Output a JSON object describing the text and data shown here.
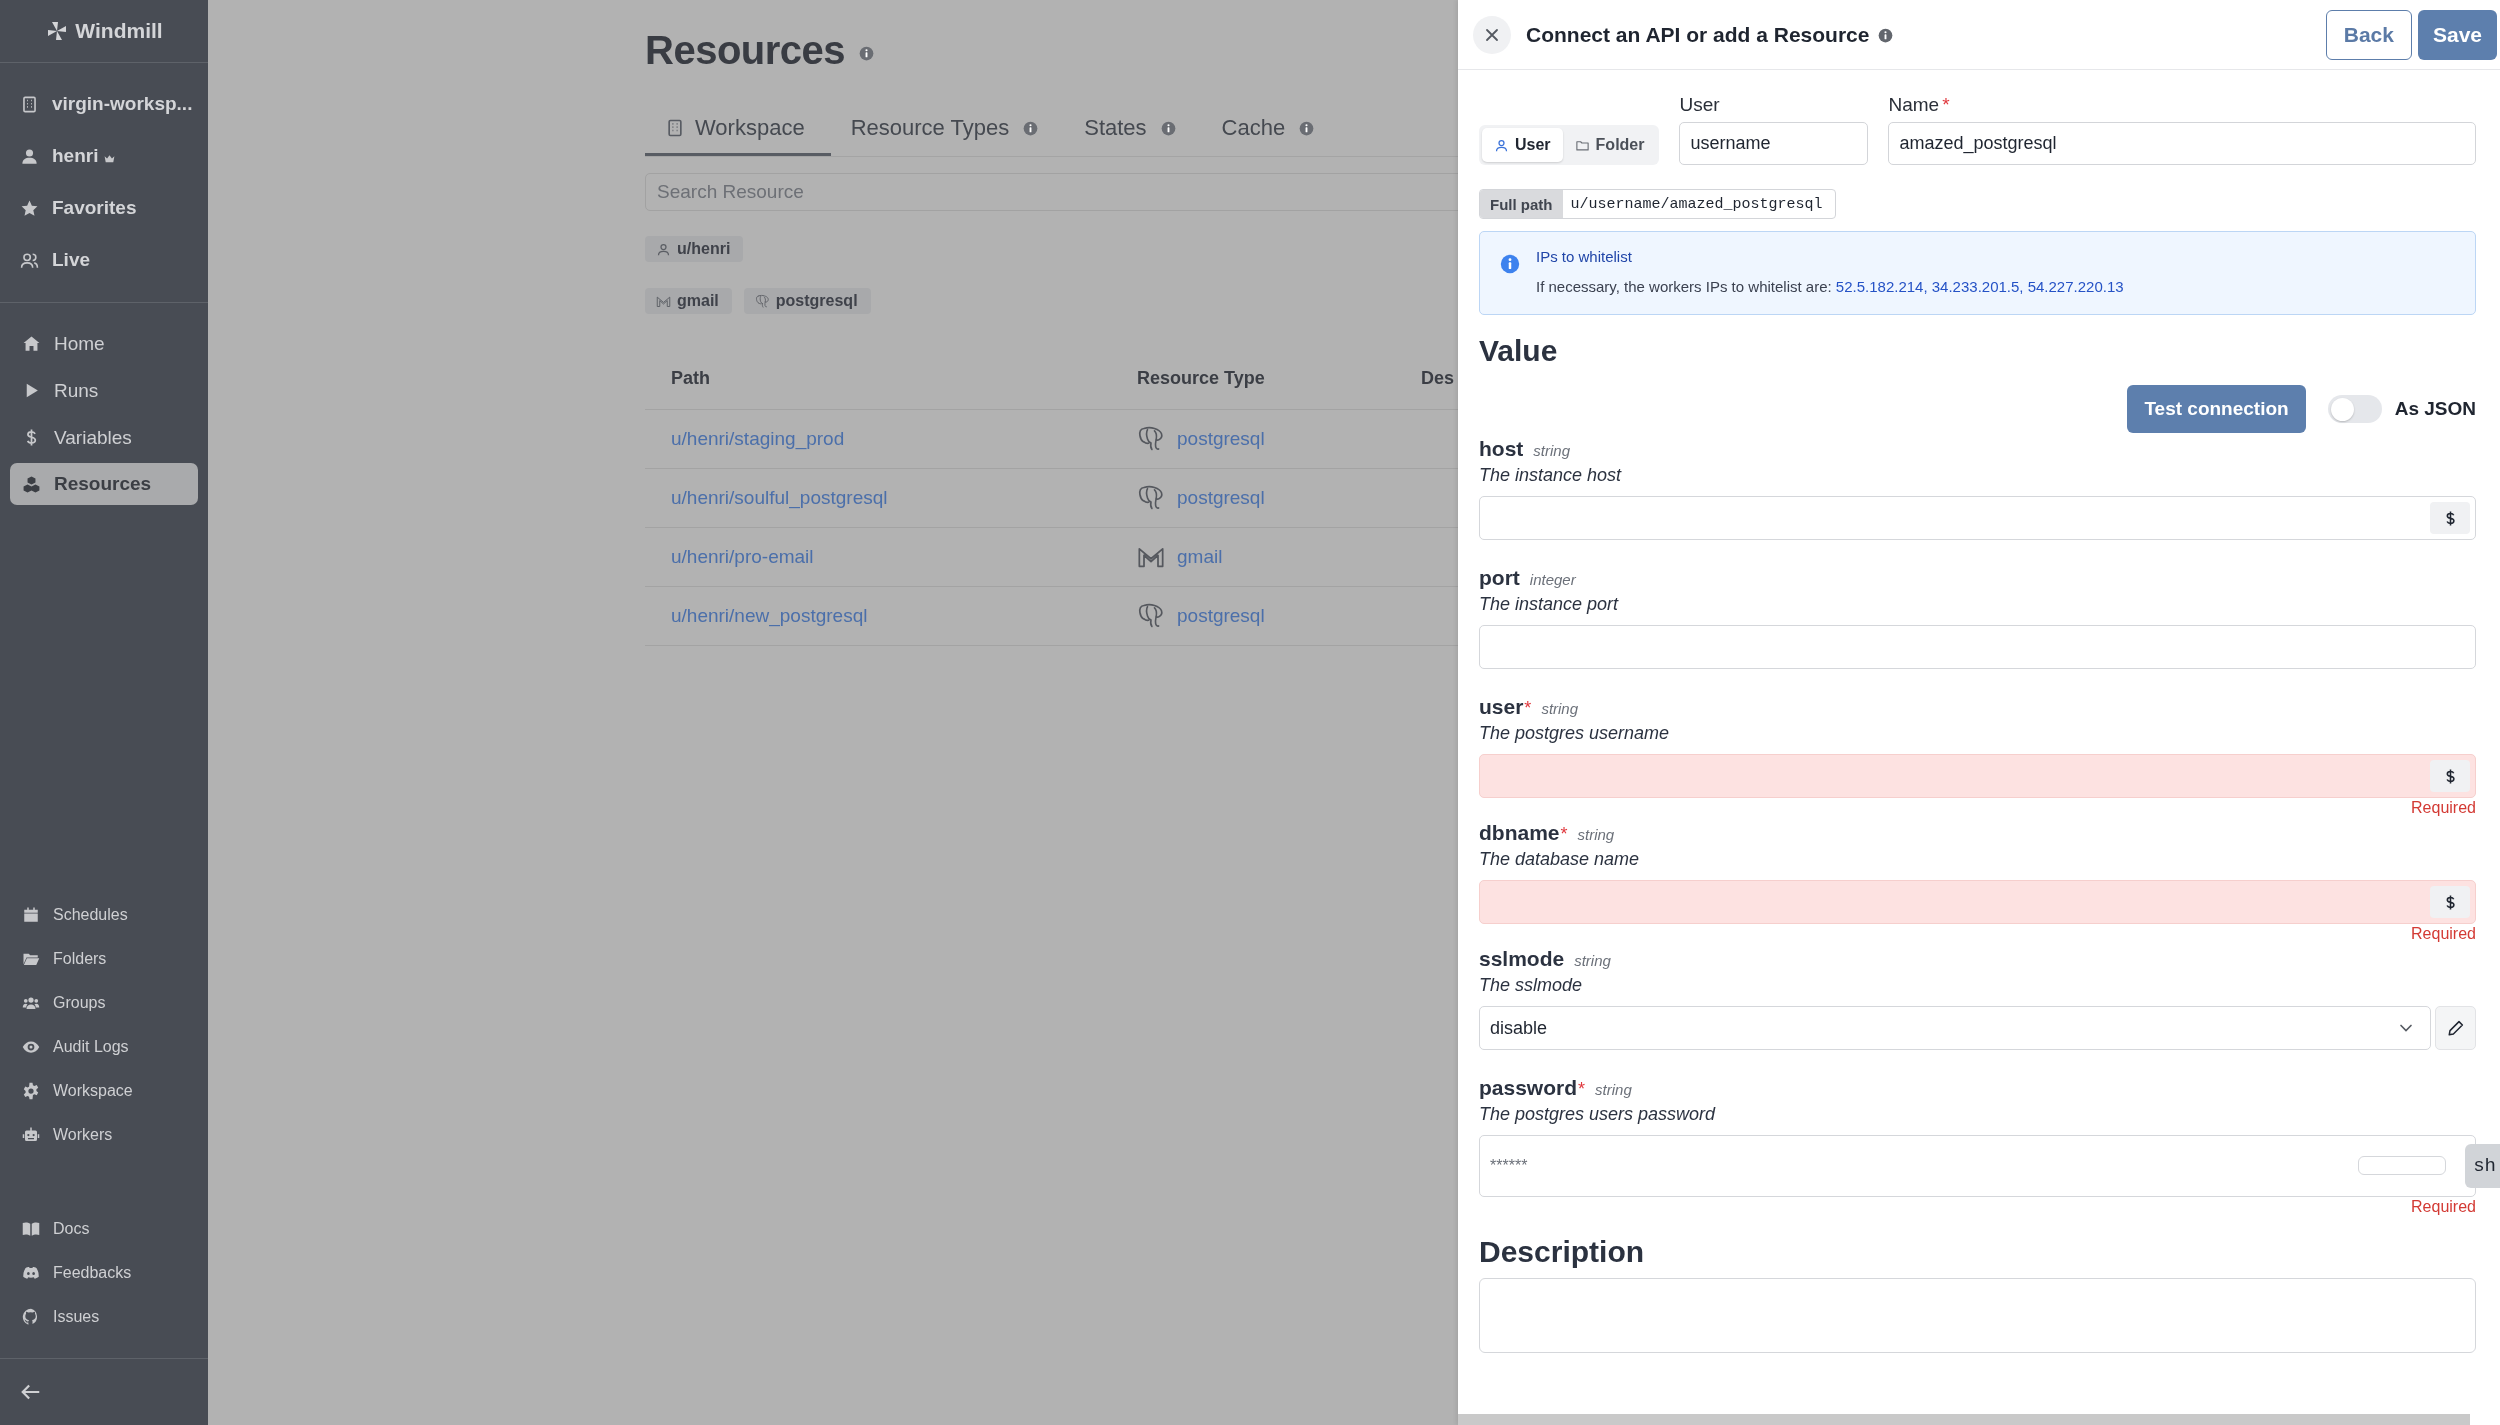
{
  "sidebar": {
    "logo": "Windmill",
    "account_items": [
      {
        "label": "virgin-worksp..."
      },
      {
        "label": "henri"
      },
      {
        "label": "Favorites"
      },
      {
        "label": "Live"
      }
    ],
    "nav_items": [
      {
        "label": "Home",
        "selected": false
      },
      {
        "label": "Runs",
        "selected": false
      },
      {
        "label": "Variables",
        "selected": false
      },
      {
        "label": "Resources",
        "selected": true
      }
    ],
    "tool_items": [
      {
        "label": "Schedules",
        "selected": false
      },
      {
        "label": "Folders",
        "selected": false
      },
      {
        "label": "Groups",
        "selected": false
      },
      {
        "label": "Audit Logs",
        "selected": false
      },
      {
        "label": "Workspace",
        "selected": false
      },
      {
        "label": "Workers",
        "selected": false
      }
    ],
    "help_items": [
      {
        "label": "Docs",
        "selected": false
      },
      {
        "label": "Feedbacks",
        "selected": false
      },
      {
        "label": "Issues",
        "selected": false
      }
    ]
  },
  "main": {
    "title": "Resources",
    "tabs": [
      {
        "label": "Workspace",
        "selected": true,
        "info": false
      },
      {
        "label": "Resource Types",
        "selected": false,
        "info": true
      },
      {
        "label": "States",
        "selected": false,
        "info": true
      },
      {
        "label": "Cache",
        "selected": false,
        "info": true
      }
    ],
    "search": {
      "placeholder": "Search Resource"
    },
    "owner_filters": [
      {
        "label": "u/henri"
      }
    ],
    "type_filters": [
      {
        "label": "gmail",
        "kind": "gmail"
      },
      {
        "label": "postgresql",
        "kind": "postgresql"
      }
    ],
    "table": {
      "columns": [
        "Path",
        "Resource Type",
        "Des"
      ],
      "rows": [
        {
          "path": "u/henri/staging_prod",
          "type": "postgresql",
          "kind": "postgresql"
        },
        {
          "path": "u/henri/soulful_postgresql",
          "type": "postgresql",
          "kind": "postgresql"
        },
        {
          "path": "u/henri/pro-email",
          "type": "gmail",
          "kind": "gmail"
        },
        {
          "path": "u/henri/new_postgresql",
          "type": "postgresql",
          "kind": "postgresql"
        }
      ]
    }
  },
  "drawer": {
    "title": "Connect an API or add a Resource",
    "buttons": [
      "Back",
      "Save"
    ],
    "owner_kinds": [
      {
        "label": "User",
        "selected": true
      },
      {
        "label": "Folder",
        "selected": false
      }
    ],
    "user_field": {
      "label": "User",
      "value": "username"
    },
    "name_field": {
      "label": "Name",
      "required_mark": "*",
      "value": "amazed_postgresql"
    },
    "full_path": {
      "label": "Full path",
      "value": "u/username/amazed_postgresql"
    },
    "alert": {
      "title": "IPs to whitelist",
      "text": "If necessary, the workers IPs to whitelist are:",
      "ips": "52.5.182.214, 34.233.201.5, 54.227.220.13"
    },
    "value_heading": "Value",
    "test_button": "Test connection",
    "json_toggle": {
      "label": "As JSON",
      "on": false
    },
    "fields": [
      {
        "name": "host",
        "type": "string",
        "description": "The instance host",
        "kind": "text",
        "invalid": false
      },
      {
        "name": "port",
        "type": "integer",
        "description": "The instance port",
        "kind": "number",
        "invalid": false
      },
      {
        "name": "user",
        "required_mark": "*",
        "type": "string",
        "description": "The postgres username",
        "kind": "text",
        "invalid": true,
        "error": "Required"
      },
      {
        "name": "dbname",
        "required_mark": "*",
        "type": "string",
        "description": "The database name",
        "kind": "text",
        "invalid": true,
        "error": "Required"
      },
      {
        "name": "sslmode",
        "type": "string",
        "description": "The sslmode",
        "kind": "select",
        "value": "disable",
        "invalid": false
      },
      {
        "name": "password",
        "required_mark": "*",
        "type": "string",
        "description": "The postgres users password",
        "kind": "password",
        "placeholder": "******",
        "show_button": "sh",
        "invalid": false,
        "error": "Required"
      }
    ],
    "description_heading": "Description"
  }
}
